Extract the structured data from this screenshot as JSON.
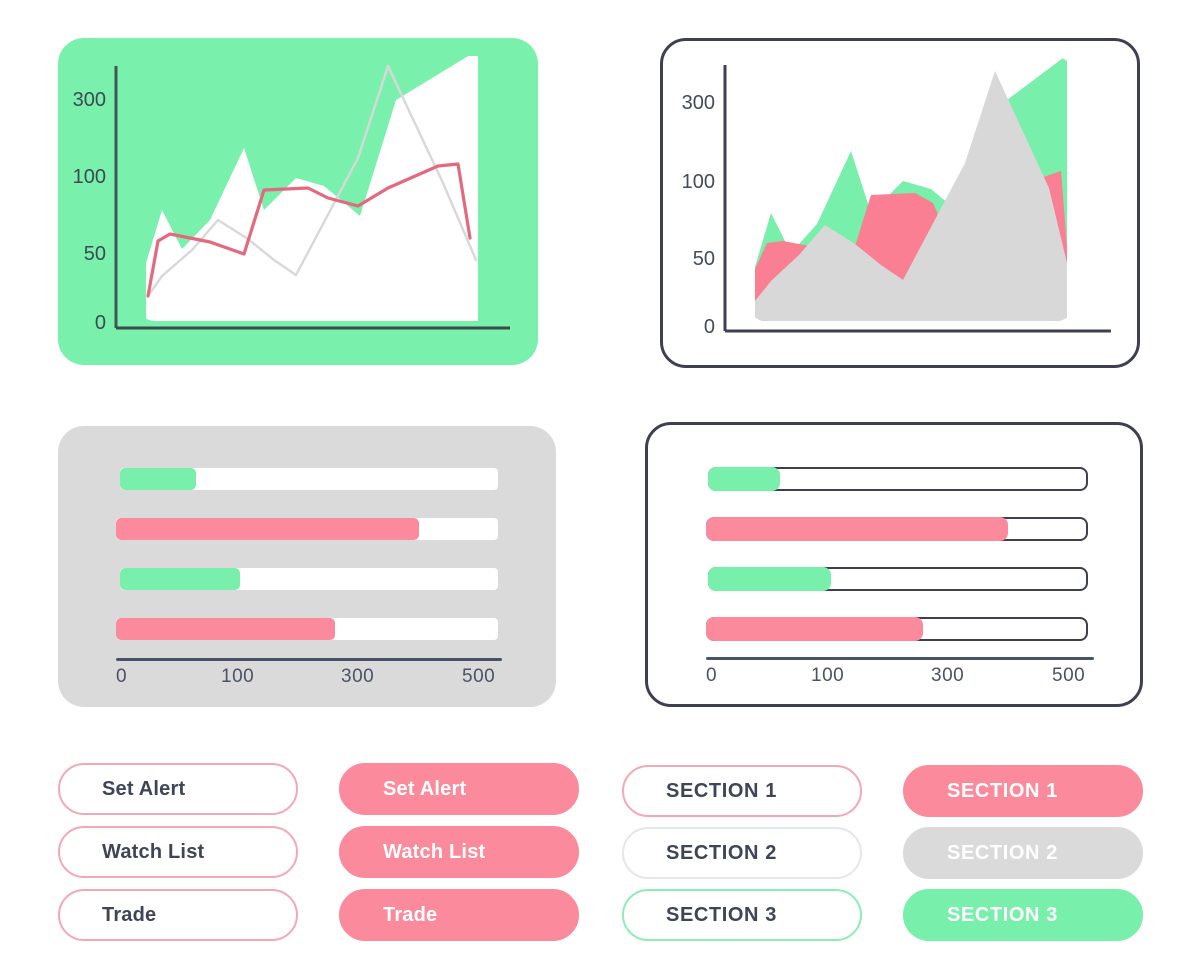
{
  "palette": {
    "green": "#78efab",
    "card_green": "#79f0ab",
    "pink": "#fb8a9c",
    "gray": "#dadada",
    "dark_slate": "#3e3f50",
    "axis_text": "#4a5268",
    "white": "#ffffff"
  },
  "chart_data": [
    {
      "id": "line-chart-green-card",
      "type": "line",
      "title": "",
      "xlabel": "",
      "ylabel": "",
      "grid": false,
      "legend": "none",
      "ytick_labels": [
        "300",
        "100",
        "50",
        "0"
      ],
      "ytick_values": [
        300,
        100,
        50,
        0
      ],
      "ylim": [
        0,
        340
      ],
      "x": [
        0,
        1,
        2,
        3,
        4,
        5,
        6,
        7,
        8,
        9,
        10
      ],
      "series": [
        {
          "name": "area-white",
          "style": "area",
          "color": "#ffffff",
          "values": [
            20,
            95,
            55,
            130,
            230,
            110,
            160,
            150,
            115,
            245,
            300
          ]
        },
        {
          "name": "line-pink",
          "style": "line",
          "color": "#e4697e",
          "values": [
            20,
            58,
            55,
            48,
            44,
            92,
            90,
            78,
            95,
            118,
            62
          ]
        },
        {
          "name": "line-gray",
          "style": "line",
          "color": "#d6d6d6",
          "values": [
            18,
            34,
            64,
            95,
            72,
            52,
            40,
            160,
            282,
            150,
            62
          ]
        }
      ]
    },
    {
      "id": "area-chart-outline-card",
      "type": "area",
      "title": "",
      "xlabel": "",
      "ylabel": "",
      "grid": false,
      "legend": "none",
      "ytick_labels": [
        "300",
        "100",
        "50",
        "0"
      ],
      "ytick_values": [
        300,
        100,
        50,
        0
      ],
      "ylim": [
        0,
        340
      ],
      "x": [
        0,
        1,
        2,
        3,
        4,
        5,
        6,
        7,
        8,
        9,
        10
      ],
      "series": [
        {
          "name": "green-area",
          "style": "area",
          "color": "#78efab",
          "values": [
            20,
            96,
            55,
            130,
            228,
            110,
            160,
            150,
            115,
            245,
            300
          ]
        },
        {
          "name": "pink-area",
          "style": "area",
          "color": "#fb7f92",
          "values": [
            20,
            58,
            56,
            50,
            44,
            92,
            92,
            40,
            115,
            160,
            118
          ]
        },
        {
          "name": "gray-area",
          "style": "area",
          "color": "#d8d8d8",
          "values": [
            12,
            36,
            64,
            97,
            72,
            52,
            40,
            160,
            280,
            150,
            62
          ]
        }
      ]
    },
    {
      "id": "bar-chart-gray-card",
      "type": "bar",
      "orientation": "horizontal",
      "title": "",
      "xlabel": "",
      "ylabel": "",
      "grid": false,
      "legend": "none",
      "xtick_labels": [
        "0",
        "100",
        "300",
        "500"
      ],
      "xtick_values": [
        0,
        100,
        300,
        500
      ],
      "xlim": [
        0,
        500
      ],
      "track_max": 500,
      "categories": [
        "bar-1",
        "bar-2",
        "bar-3",
        "bar-4"
      ],
      "values": [
        70,
        390,
        105,
        235
      ],
      "colors": [
        "#78efab",
        "#fb8a9c",
        "#78efab",
        "#fb8a9c"
      ]
    },
    {
      "id": "bar-chart-outline-card",
      "type": "bar",
      "orientation": "horizontal",
      "title": "",
      "xlabel": "",
      "ylabel": "",
      "grid": false,
      "legend": "none",
      "xtick_labels": [
        "0",
        "100",
        "300",
        "500"
      ],
      "xtick_values": [
        0,
        100,
        300,
        500
      ],
      "xlim": [
        0,
        500
      ],
      "track_max": 500,
      "categories": [
        "bar-1",
        "bar-2",
        "bar-3",
        "bar-4"
      ],
      "values": [
        72,
        390,
        122,
        235
      ],
      "colors": [
        "#78efab",
        "#fb8a9c",
        "#78efab",
        "#fb8a9c"
      ]
    }
  ],
  "panels": {
    "line_chart_green": {
      "name": "Line chart on green card"
    },
    "area_chart_outline": {
      "name": "Area chart on outlined card"
    },
    "bar_chart_gray": {
      "name": "Bar chart on gray card"
    },
    "bar_chart_outline": {
      "name": "Bar chart on outlined card"
    }
  },
  "buttons": {
    "column_outline_pink": [
      {
        "label": "Set Alert"
      },
      {
        "label": "Watch List"
      },
      {
        "label": "Trade"
      }
    ],
    "column_solid_pink": [
      {
        "label": "Set Alert"
      },
      {
        "label": "Watch List"
      },
      {
        "label": "Trade"
      }
    ],
    "column_outline_sections": [
      {
        "label": "SECTION 1"
      },
      {
        "label": "SECTION 2"
      },
      {
        "label": "SECTION 3"
      }
    ],
    "column_solid_sections": [
      {
        "label": "SECTION 1"
      },
      {
        "label": "SECTION 2"
      },
      {
        "label": "SECTION 3"
      }
    ]
  }
}
